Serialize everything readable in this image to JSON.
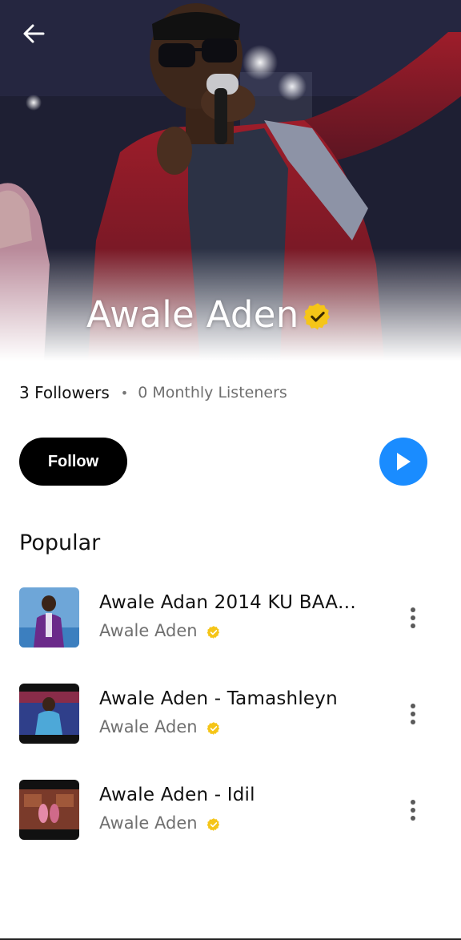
{
  "artist": {
    "name": "Awale Aden",
    "verified": true,
    "followers_text": "3 Followers",
    "separator": "•",
    "listeners_text": "0 Monthly Listeners"
  },
  "actions": {
    "follow_label": "Follow",
    "play_icon": "play-icon"
  },
  "popular": {
    "title": "Popular",
    "tracks": [
      {
        "title": "Awale Adan 2014 KU BAAQAY...",
        "artist": "Awale Aden",
        "verified": true
      },
      {
        "title": "Awale Aden - Tamashleyn",
        "artist": "Awale Aden",
        "verified": true
      },
      {
        "title": "Awale Aden - Idil",
        "artist": "Awale Aden",
        "verified": true
      }
    ]
  },
  "colors": {
    "accent": "#1a8cff",
    "verified_badge": "#f5c518",
    "follow_button": "#000000"
  }
}
